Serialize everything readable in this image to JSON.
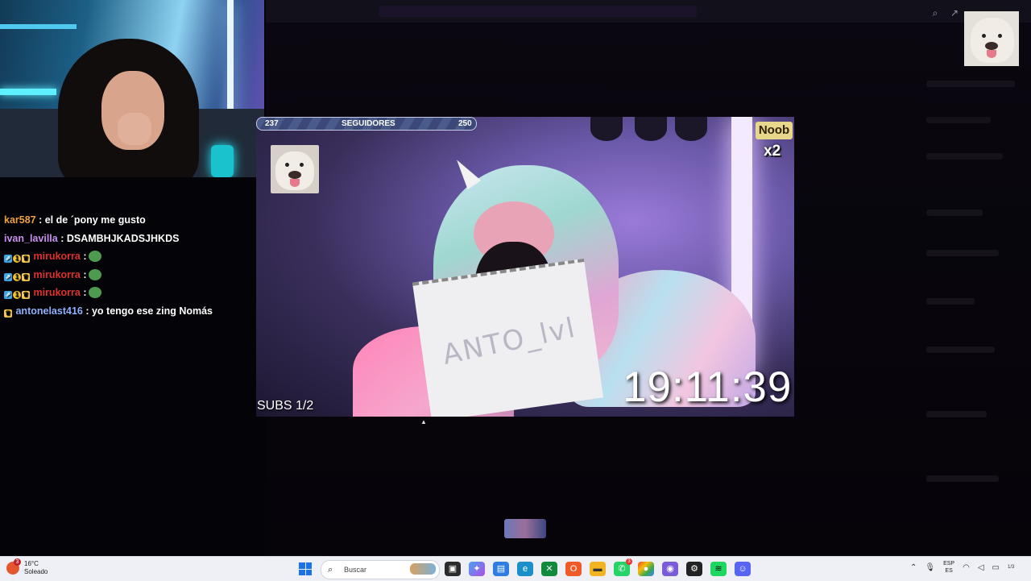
{
  "chat": {
    "messages": [
      {
        "user": "kar587",
        "color": "#f0a040",
        "text": "el de ´pony me gusto",
        "badges": []
      },
      {
        "user": "ivan_lavilla",
        "color": "#c890f0",
        "text": "DSAMBHJKADSJHKDS",
        "badges": []
      },
      {
        "user": "mirukorra",
        "color": "#e03030",
        "text": "",
        "badges": [
          "prime",
          "1",
          "crown"
        ],
        "emote": "pepe-emote"
      },
      {
        "user": "mirukorra",
        "color": "#e03030",
        "text": "",
        "badges": [
          "prime",
          "1",
          "crown"
        ],
        "emote": "pepe-emote"
      },
      {
        "user": "mirukorra",
        "color": "#e03030",
        "text": "",
        "badges": [
          "prime",
          "1",
          "crown"
        ],
        "emote": "pepe-emote"
      },
      {
        "user": "antonelast416",
        "color": "#8fb0ff",
        "text": "yo tengo ese zing Nomás",
        "badges": [
          "crown"
        ]
      }
    ]
  },
  "overlay": {
    "followers": {
      "min": "237",
      "label": "SEGUIDORES",
      "max": "250"
    },
    "noob": "Noob",
    "multiplier": "x2",
    "clock": "19:11:39",
    "subs": "SUBS 1/2",
    "paper_text": "ANTO_lvl"
  },
  "taskbar": {
    "weather_temp": "16°C",
    "weather_desc": "Soleado",
    "weather_badge": "3",
    "search_placeholder": "Buscar",
    "lang_top": "ESP",
    "lang_bottom": "ES",
    "page_indicator": "1/3"
  },
  "icons": {
    "zoom": "zoom-icon",
    "share": "share-icon"
  }
}
